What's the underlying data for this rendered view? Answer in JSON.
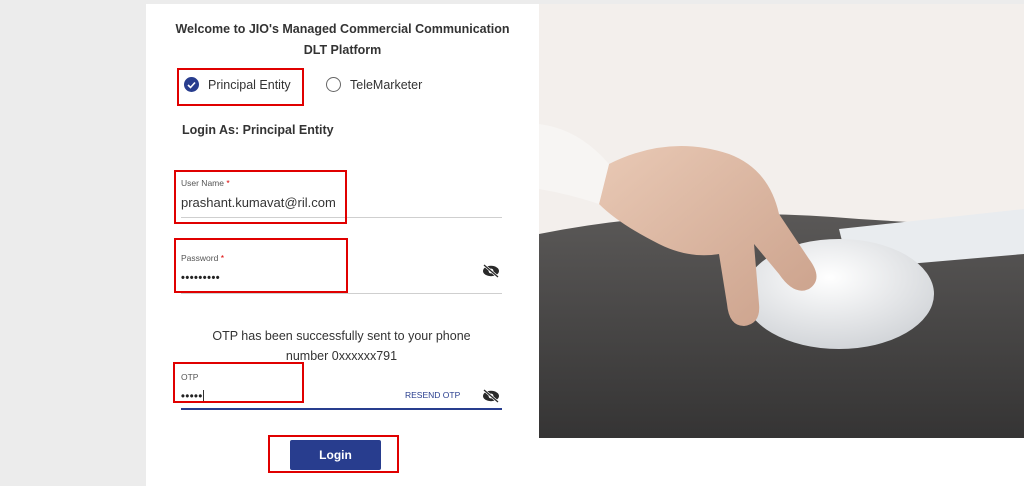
{
  "header": {
    "title_line1": "Welcome to JIO's Managed Commercial Communication",
    "title_line2": "DLT Platform"
  },
  "entity_options": [
    {
      "label": "Principal Entity",
      "selected": true
    },
    {
      "label": "TeleMarketer",
      "selected": false
    }
  ],
  "login_as": "Login As: Principal Entity",
  "form": {
    "username": {
      "label": "User Name",
      "required_mark": "*",
      "value": "prashant.kumavat@ril.com"
    },
    "password": {
      "label": "Password",
      "required_mark": "*",
      "value": "•••••••••"
    },
    "otp_message_line1": "OTP has been successfully sent to your phone",
    "otp_message_line2": "number 0xxxxxx791",
    "otp": {
      "label": "OTP",
      "value": "•••••"
    },
    "resend_label": "RESEND OTP",
    "login_label": "Login"
  },
  "colors": {
    "accent": "#283d8e",
    "highlight_box": "#e00000",
    "required": "#dd0000"
  },
  "icons": [
    "check-icon",
    "eye-slash-icon"
  ]
}
